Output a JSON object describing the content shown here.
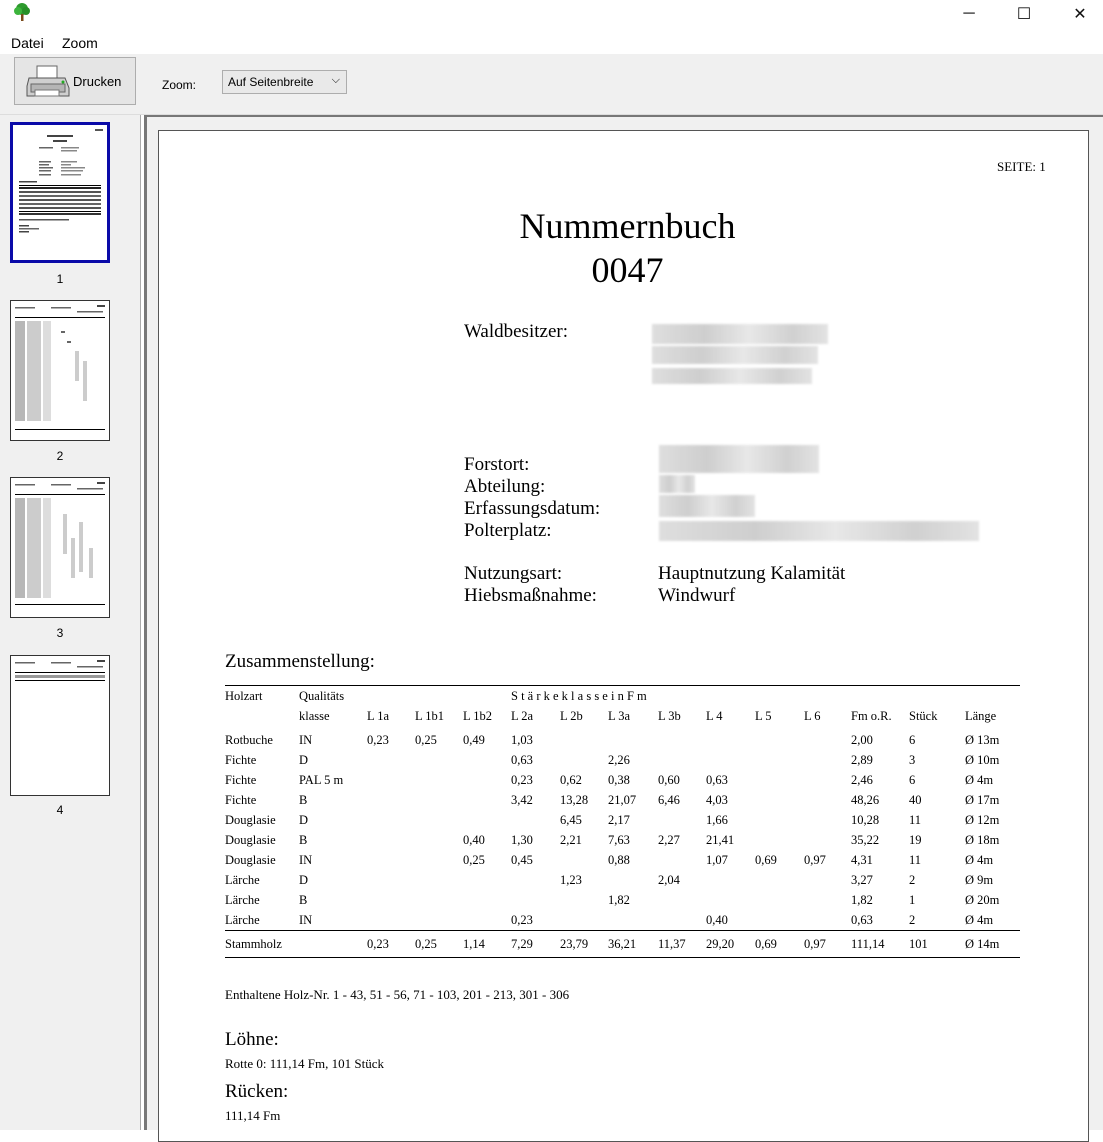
{
  "window": {
    "minimize": "─",
    "maximize": "☐",
    "close": "✕"
  },
  "menu": {
    "file": "Datei",
    "zoom": "Zoom"
  },
  "toolbar": {
    "print_label": "Drucken",
    "zoom_label": "Zoom:",
    "zoom_value": "Auf Seitenbreite"
  },
  "thumbnails": [
    {
      "num": "1"
    },
    {
      "num": "2"
    },
    {
      "num": "3"
    },
    {
      "num": "4"
    }
  ],
  "page": {
    "seite": "SEITE: 1",
    "title": "Nummernbuch",
    "number": "0047",
    "waldbesitzer_label": "Waldbesitzer:",
    "forstort_label": "Forstort:",
    "abteilung_label": "Abteilung:",
    "erfassungsdatum_label": "Erfassungsdatum:",
    "polterplatz_label": "Polterplatz:",
    "nutzungsart_label": "Nutzungsart:",
    "nutzungsart_value": "Hauptnutzung Kalamität",
    "hiebsmassnahme_label": "Hiebsmaßnahme:",
    "hiebsmassnahme_value": "Windwurf",
    "zusammenstellung": "Zusammenstellung:",
    "holz_nr": "Enthaltene Holz-Nr. 1 - 43, 51 - 56, 71 - 103, 201 - 213, 301 - 306",
    "loehne_title": "Löhne:",
    "loehne_text": "Rotte 0: 111,14 Fm, 101 Stück",
    "ruecken_title": "Rücken:",
    "ruecken_text": "111,14 Fm"
  },
  "table": {
    "h1": {
      "holzart": "Holzart",
      "qual": "Qualitäts",
      "staerke": "S t ä r k e k l a s s e   i n   F m"
    },
    "h2": [
      "klasse",
      "L 1a",
      "L 1b1",
      "L 1b2",
      "L 2a",
      "L 2b",
      "L 3a",
      "L 3b",
      "L 4",
      "L 5",
      "L 6",
      "Fm o.R.",
      "Stück",
      "Länge"
    ],
    "rows": [
      [
        "Rotbuche",
        "IN",
        "0,23",
        "0,25",
        "0,49",
        "1,03",
        "",
        "",
        "",
        "",
        "",
        "",
        "2,00",
        "6",
        "Ø 13m"
      ],
      [
        "Fichte",
        "D",
        "",
        "",
        "",
        "0,63",
        "",
        "2,26",
        "",
        "",
        "",
        "",
        "2,89",
        "3",
        "Ø 10m"
      ],
      [
        "Fichte",
        "PAL 5 m",
        "",
        "",
        "",
        "0,23",
        "0,62",
        "0,38",
        "0,60",
        "0,63",
        "",
        "",
        "2,46",
        "6",
        "Ø 4m"
      ],
      [
        "Fichte",
        "B",
        "",
        "",
        "",
        "3,42",
        "13,28",
        "21,07",
        "6,46",
        "4,03",
        "",
        "",
        "48,26",
        "40",
        "Ø 17m"
      ],
      [
        "Douglasie",
        "D",
        "",
        "",
        "",
        "",
        "6,45",
        "2,17",
        "",
        "1,66",
        "",
        "",
        "10,28",
        "11",
        "Ø 12m"
      ],
      [
        "Douglasie",
        "B",
        "",
        "",
        "0,40",
        "1,30",
        "2,21",
        "7,63",
        "2,27",
        "21,41",
        "",
        "",
        "35,22",
        "19",
        "Ø 18m"
      ],
      [
        "Douglasie",
        "IN",
        "",
        "",
        "0,25",
        "0,45",
        "",
        "0,88",
        "",
        "1,07",
        "0,69",
        "0,97",
        "4,31",
        "11",
        "Ø 4m"
      ],
      [
        "Lärche",
        "D",
        "",
        "",
        "",
        "",
        "1,23",
        "",
        "2,04",
        "",
        "",
        "",
        "3,27",
        "2",
        "Ø 9m"
      ],
      [
        "Lärche",
        "B",
        "",
        "",
        "",
        "",
        "",
        "1,82",
        "",
        "",
        "",
        "",
        "1,82",
        "1",
        "Ø 20m"
      ],
      [
        "Lärche",
        "IN",
        "",
        "",
        "",
        "0,23",
        "",
        "",
        "",
        "0,40",
        "",
        "",
        "0,63",
        "2",
        "Ø 4m"
      ]
    ],
    "total": [
      "Stammholz",
      "",
      "0,23",
      "0,25",
      "1,14",
      "7,29",
      "23,79",
      "36,21",
      "11,37",
      "29,20",
      "0,69",
      "0,97",
      "111,14",
      "101",
      "Ø 14m"
    ]
  }
}
